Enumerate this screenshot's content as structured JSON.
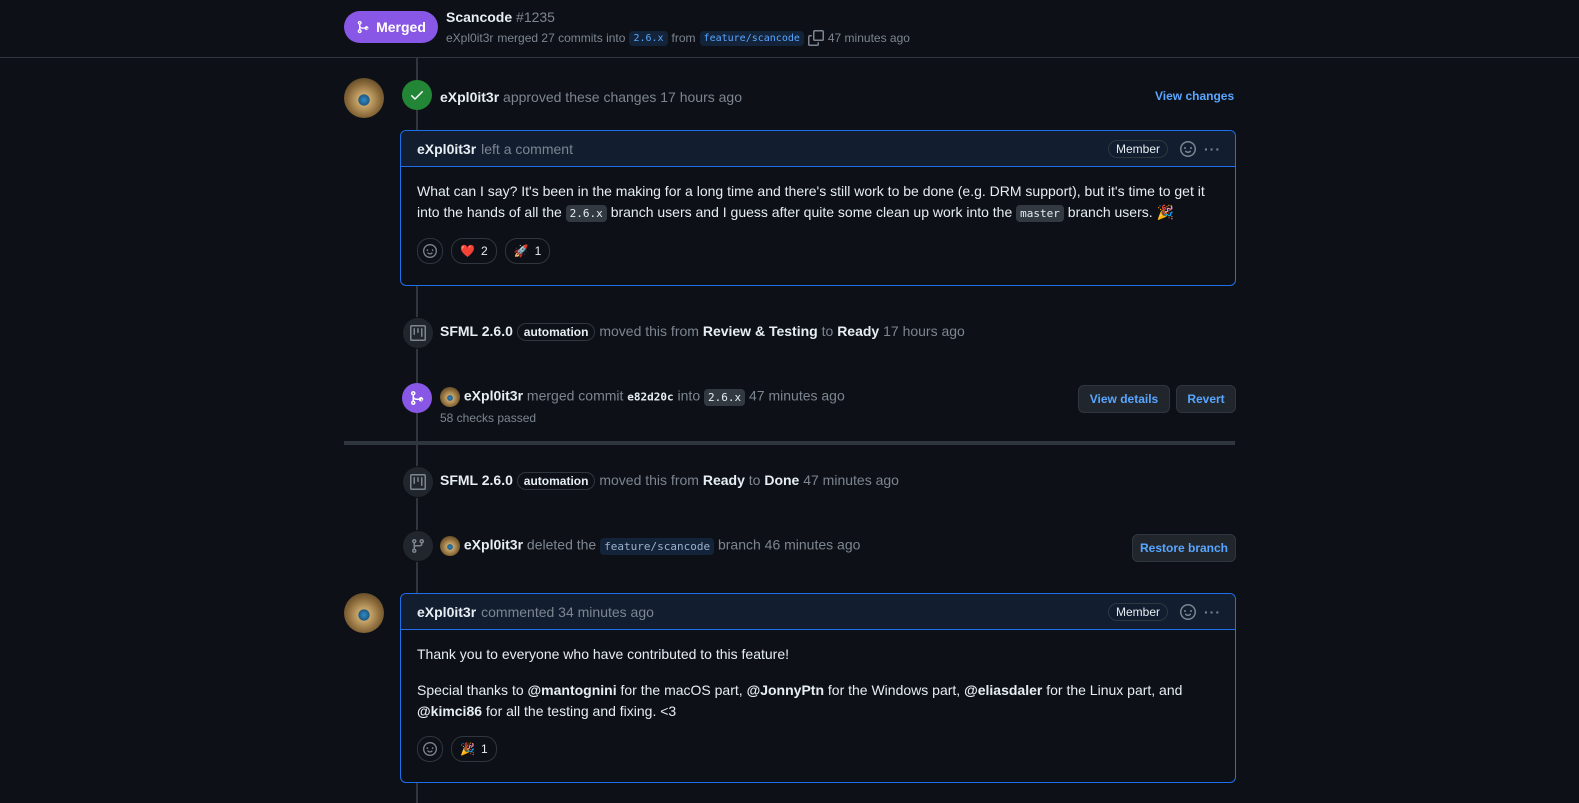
{
  "header": {
    "status_label": "Merged",
    "title": "Scancode",
    "number": "#1235",
    "author": "eXpl0it3r",
    "merged_text": "merged 27 commits into",
    "base_branch": "2.6.x",
    "from_text": "from",
    "head_branch": "feature/scancode",
    "time": "47 minutes ago"
  },
  "approval": {
    "author": "eXpl0it3r",
    "text": "approved these changes 17 hours ago",
    "button": "View changes"
  },
  "review_comment": {
    "author": "eXpl0it3r",
    "action": "left a comment",
    "badge": "Member",
    "body_part1": "What can I say? It's been in the making for a long time and there's still work to be done (e.g. DRM support), but it's time to get it into the hands of all the",
    "code1": "2.6.x",
    "body_part2": "branch users and I guess after quite some clean up work into the",
    "code2": "master",
    "body_part3": "branch users. 🎉",
    "reactions": [
      {
        "emoji": "❤️",
        "count": "2"
      },
      {
        "emoji": "🚀",
        "count": "1"
      }
    ]
  },
  "project_move1": {
    "project": "SFML 2.6.0",
    "label": "automation",
    "text1": "moved this from",
    "from": "Review & Testing",
    "text2": "to",
    "to": "Ready",
    "time": "17 hours ago"
  },
  "merge_event": {
    "author": "eXpl0it3r",
    "text1": "merged commit",
    "commit": "e82d20c",
    "text2": "into",
    "branch": "2.6.x",
    "time": "47 minutes ago",
    "checks": "58 checks passed",
    "view_details": "View details",
    "revert": "Revert"
  },
  "project_move2": {
    "project": "SFML 2.6.0",
    "label": "automation",
    "text1": "moved this from",
    "from": "Ready",
    "text2": "to",
    "to": "Done",
    "time": "47 minutes ago"
  },
  "branch_delete": {
    "author": "eXpl0it3r",
    "text1": "deleted the",
    "branch": "feature/scancode",
    "text2": "branch 46 minutes ago",
    "button": "Restore branch"
  },
  "final_comment": {
    "author": "eXpl0it3r",
    "action": "commented 34 minutes ago",
    "badge": "Member",
    "line1": "Thank you to everyone who have contributed to this feature!",
    "p2_a": "Special thanks to",
    "m1": "@mantognini",
    "p2_b": "for the macOS part,",
    "m2": "@JonnyPtn",
    "p2_c": "for the Windows part,",
    "m3": "@eliasdaler",
    "p2_d": "for the Linux part, and",
    "m4": "@kimci86",
    "p2_e": "for all the testing and fixing. <3",
    "reactions": [
      {
        "emoji": "🎉",
        "count": "1"
      }
    ]
  },
  "colors": {
    "merged": "#8957e5",
    "approved": "#238636",
    "link": "#58a6ff",
    "border_focus": "#1f6feb"
  }
}
